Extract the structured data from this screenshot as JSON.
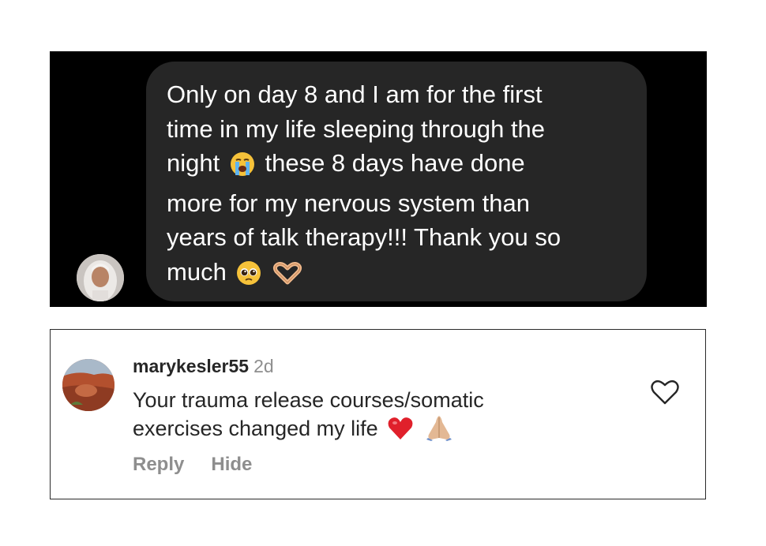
{
  "message": {
    "lines": [
      "Only on day 8 and I am for the first",
      "time in my life sleeping through the",
      "night",
      "these 8 days have done",
      "more for my nervous system than",
      "years of talk therapy!!! Thank you so",
      "much"
    ],
    "emojis": [
      "loudly-crying-face",
      "pleading-face",
      "heart-hands"
    ]
  },
  "comment": {
    "username": "marykesler55",
    "time": "2d",
    "text_line1": "Your trauma release courses/somatic",
    "text_line2": "exercises changed my life",
    "emojis": [
      "red-heart",
      "folded-hands"
    ],
    "reply_label": "Reply",
    "hide_label": "Hide",
    "like_icon": "heart-outline-icon"
  },
  "colors": {
    "dm_background": "#000000",
    "bubble": "#262626",
    "message_text": "#ffffff",
    "username": "#262626",
    "secondary_text": "#8e8e8e",
    "red_heart": "#e0202b"
  }
}
